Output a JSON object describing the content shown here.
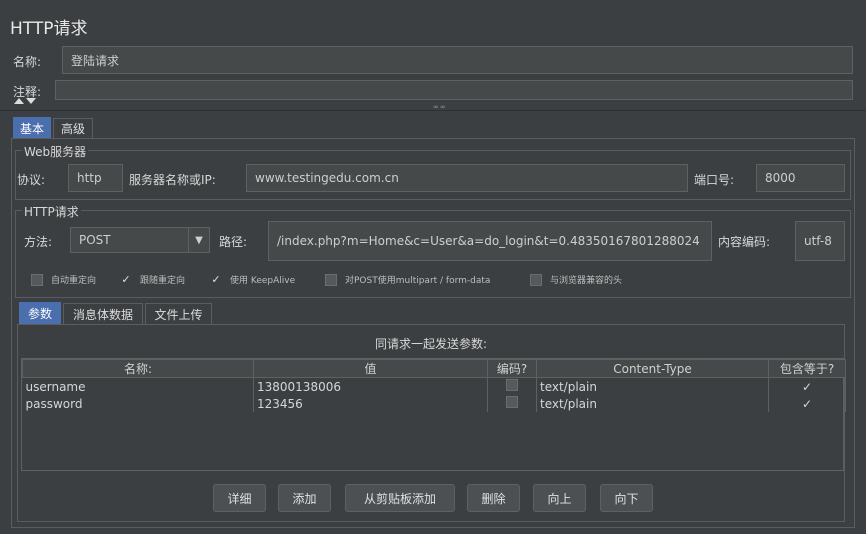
{
  "header": {
    "title": "HTTP请求",
    "name_label": "名称:",
    "name_value": "登陆请求",
    "comment_label": "注释:",
    "comment_value": "",
    "splitter_glyph": "∞∞"
  },
  "tabs": {
    "basic": "基本",
    "advanced": "高级"
  },
  "web_server": {
    "section_title": "Web服务器",
    "protocol_label": "协议:",
    "protocol_value": "http",
    "server_label": "服务器名称或IP:",
    "server_value": "www.testingedu.com.cn",
    "port_label": "端口号:",
    "port_value": "8000"
  },
  "http_request": {
    "section_title": "HTTP请求",
    "method_label": "方法:",
    "method_value": "POST",
    "path_label": "路径:",
    "path_value": "/index.php?m=Home&c=User&a=do_login&t=0.48350167801288024",
    "encoding_label": "内容编码:",
    "encoding_value": "utf-8"
  },
  "options": [
    {
      "label": "自动重定向",
      "checked": false
    },
    {
      "label": "跟随重定向",
      "checked": true
    },
    {
      "label": "使用 KeepAlive",
      "checked": true
    },
    {
      "label": "对POST使用multipart / form-data",
      "checked": false
    },
    {
      "label": "与浏览器兼容的头",
      "checked": false
    }
  ],
  "inner_tabs": {
    "params": "参数",
    "body": "消息体数据",
    "files": "文件上传"
  },
  "params_table": {
    "caption": "同请求一起发送参数:",
    "headers": [
      "名称:",
      "值",
      "编码?",
      "Content-Type",
      "包含等于?"
    ],
    "rows": [
      {
        "name": "username",
        "value": "13800138006",
        "encode": false,
        "content_type": "text/plain",
        "include_equals": true
      },
      {
        "name": "password",
        "value": "123456",
        "encode": false,
        "content_type": "text/plain",
        "include_equals": true
      }
    ]
  },
  "buttons": {
    "detail": "详细",
    "add": "添加",
    "add_clipboard": "从剪贴板添加",
    "delete": "删除",
    "up": "向上",
    "down": "向下"
  },
  "glyphs": {
    "checkmark": "✓",
    "dropdown": "▼"
  }
}
